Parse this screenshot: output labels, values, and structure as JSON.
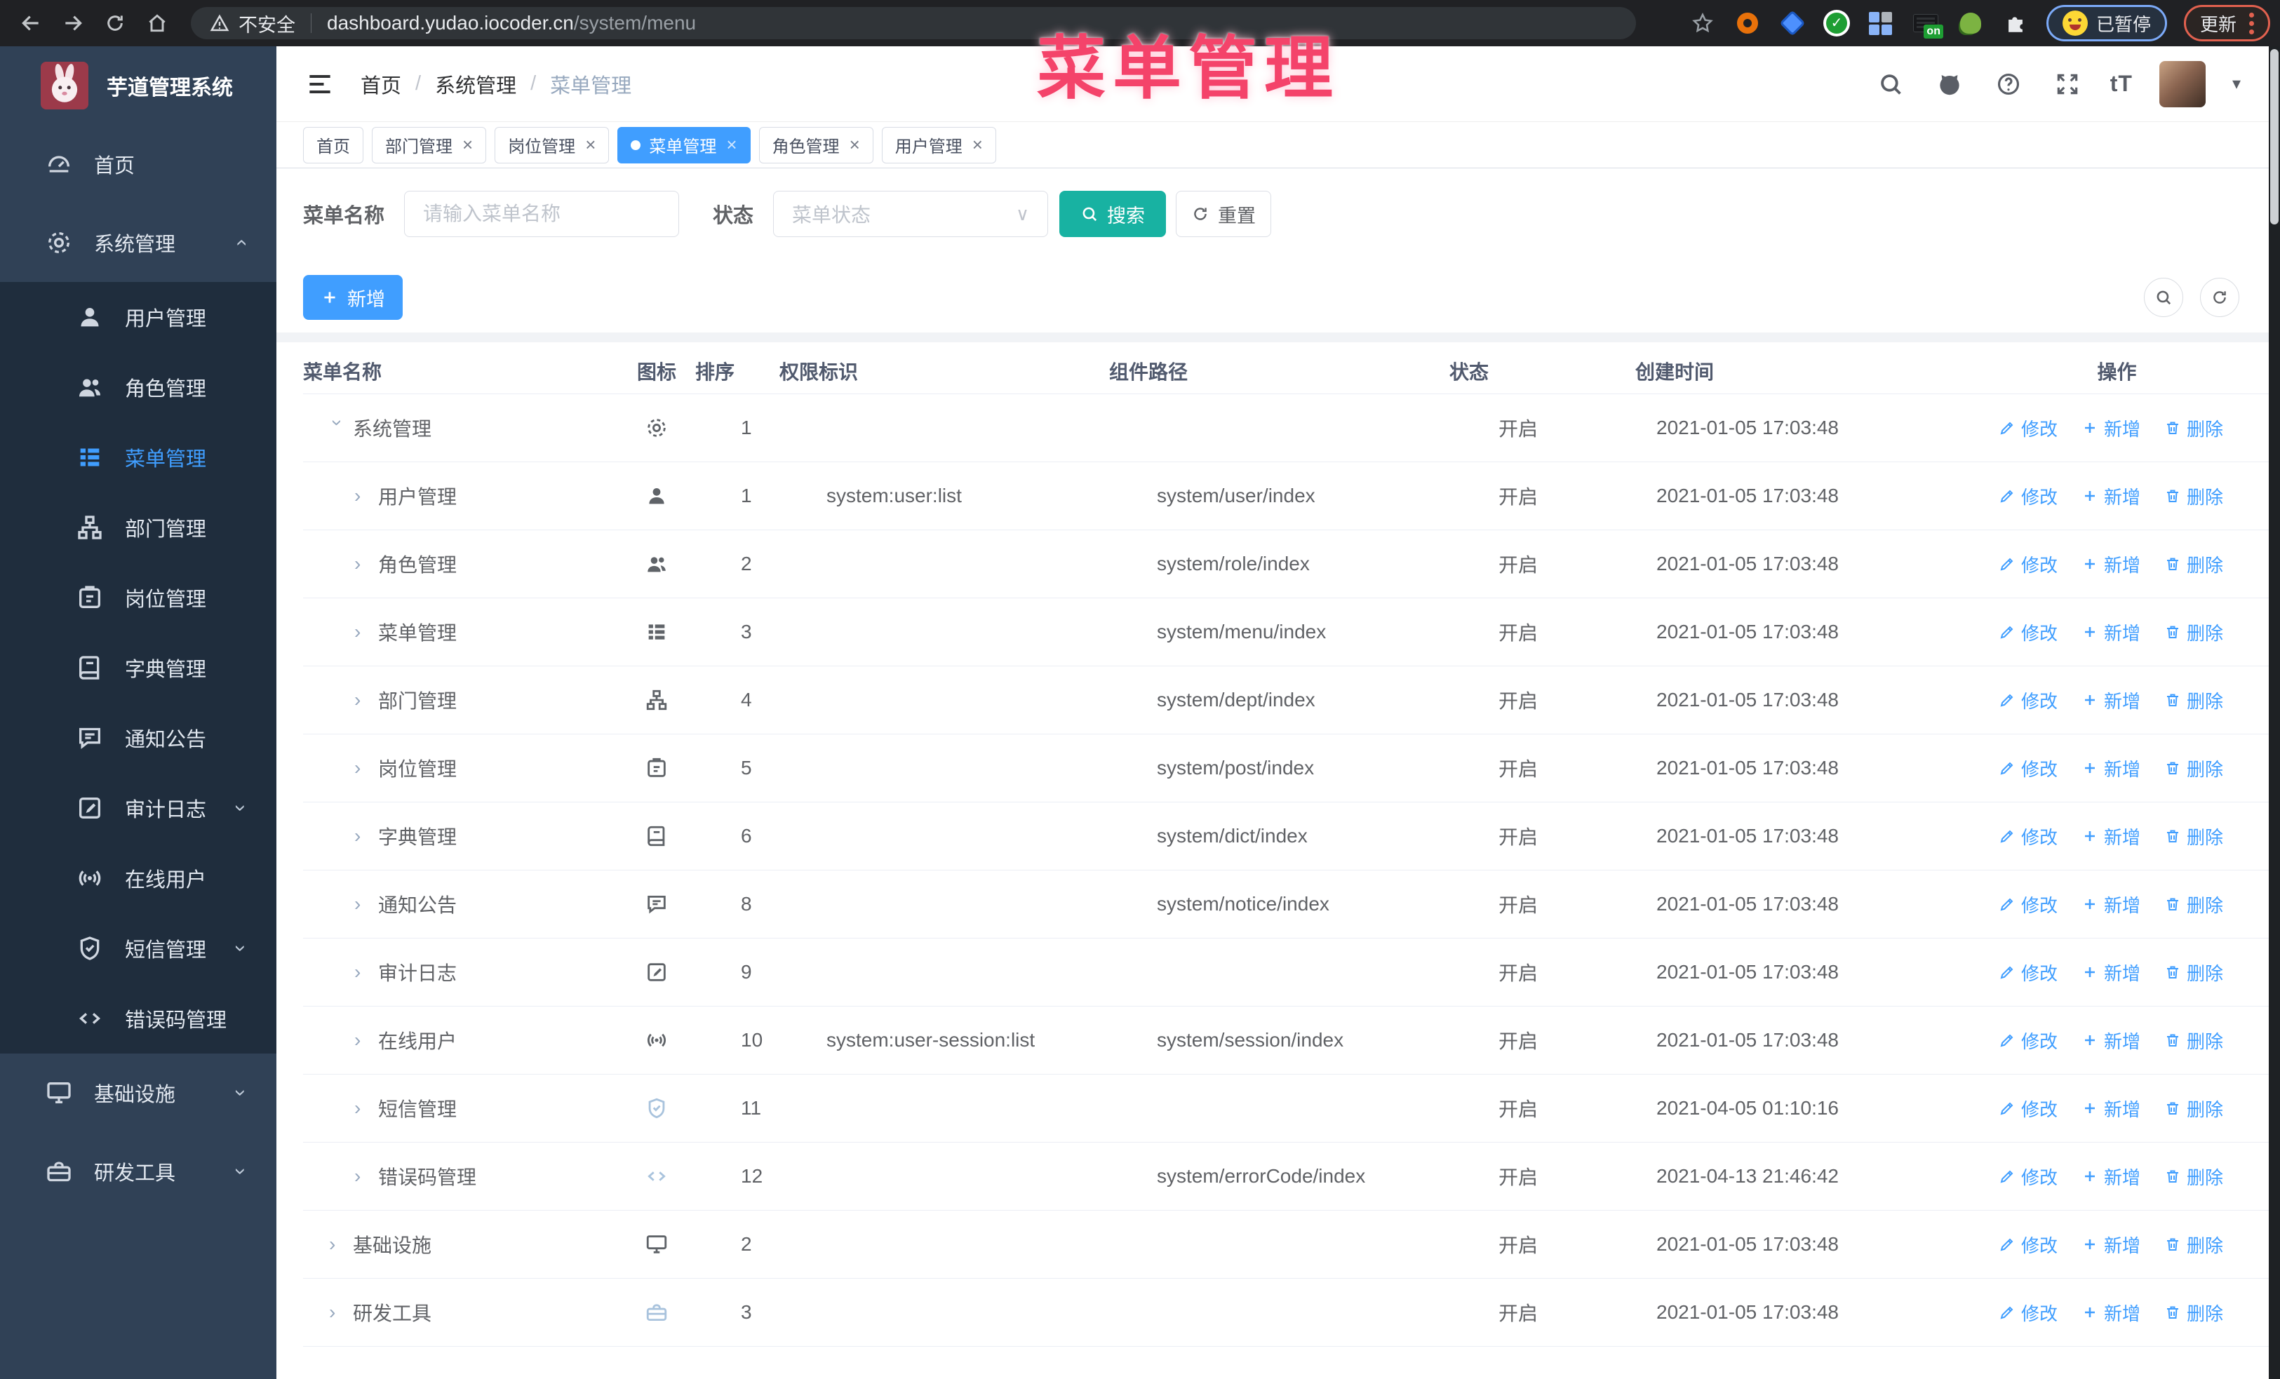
{
  "browser": {
    "security_label": "不安全",
    "url_host": "dashboard.yudao.iocoder.cn",
    "url_path": "/system/menu",
    "profile_badge": "已暂停",
    "update_button": "更新",
    "extension_on_badge": "on"
  },
  "overlay": {
    "title": "菜单管理",
    "color": "#f4436a"
  },
  "sidebar": {
    "app_title": "芋道管理系统",
    "items": [
      {
        "label": "首页",
        "icon": "dashboard",
        "level": 0
      },
      {
        "label": "系统管理",
        "icon": "gear",
        "level": 0,
        "arrow": "up"
      },
      {
        "label": "用户管理",
        "icon": "user",
        "level": 1
      },
      {
        "label": "角色管理",
        "icon": "users",
        "level": 1
      },
      {
        "label": "菜单管理",
        "icon": "menu",
        "level": 1,
        "active": true
      },
      {
        "label": "部门管理",
        "icon": "tree",
        "level": 1
      },
      {
        "label": "岗位管理",
        "icon": "post",
        "level": 1
      },
      {
        "label": "字典管理",
        "icon": "dict",
        "level": 1
      },
      {
        "label": "通知公告",
        "icon": "message",
        "level": 1
      },
      {
        "label": "审计日志",
        "icon": "log",
        "level": 1,
        "arrow": "down"
      },
      {
        "label": "在线用户",
        "icon": "online",
        "level": 1
      },
      {
        "label": "短信管理",
        "icon": "shield",
        "level": 1,
        "arrow": "down"
      },
      {
        "label": "错误码管理",
        "icon": "code",
        "level": 1
      },
      {
        "label": "基础设施",
        "icon": "monitor",
        "level": 0,
        "arrow": "down"
      },
      {
        "label": "研发工具",
        "icon": "toolbox",
        "level": 0,
        "arrow": "down"
      }
    ]
  },
  "header": {
    "breadcrumb": [
      "首页",
      "系统管理",
      "菜单管理"
    ],
    "breadcrumb_separator": "/",
    "font_size_glyph": "tT"
  },
  "tabs": {
    "close_glyph": "×",
    "items": [
      {
        "label": "首页",
        "closable": false,
        "active": false
      },
      {
        "label": "部门管理",
        "closable": true,
        "active": false
      },
      {
        "label": "岗位管理",
        "closable": true,
        "active": false
      },
      {
        "label": "菜单管理",
        "closable": true,
        "active": true
      },
      {
        "label": "角色管理",
        "closable": true,
        "active": false
      },
      {
        "label": "用户管理",
        "closable": true,
        "active": false
      }
    ]
  },
  "filters": {
    "name_label": "菜单名称",
    "name_placeholder": "请输入菜单名称",
    "status_label": "状态",
    "status_placeholder": "菜单状态",
    "search_label": "搜索",
    "reset_label": "重置"
  },
  "toolbar": {
    "add_label": "新增"
  },
  "table": {
    "columns": [
      "菜单名称",
      "图标",
      "排序",
      "权限标识",
      "组件路径",
      "状态",
      "创建时间",
      "操作"
    ],
    "actions": {
      "edit": "修改",
      "add": "新增",
      "delete": "删除"
    },
    "rows": [
      {
        "name": "系统管理",
        "icon": "gear",
        "level": 0,
        "expanded": true,
        "sort": "1",
        "perm": "",
        "path": "",
        "status": "开启",
        "time": "2021-01-05 17:03:48"
      },
      {
        "name": "用户管理",
        "icon": "user",
        "level": 1,
        "expanded": false,
        "sort": "1",
        "perm": "system:user:list",
        "path": "system/user/index",
        "status": "开启",
        "time": "2021-01-05 17:03:48"
      },
      {
        "name": "角色管理",
        "icon": "users",
        "level": 1,
        "expanded": false,
        "sort": "2",
        "perm": "",
        "path": "system/role/index",
        "status": "开启",
        "time": "2021-01-05 17:03:48"
      },
      {
        "name": "菜单管理",
        "icon": "menu",
        "level": 1,
        "expanded": false,
        "sort": "3",
        "perm": "",
        "path": "system/menu/index",
        "status": "开启",
        "time": "2021-01-05 17:03:48"
      },
      {
        "name": "部门管理",
        "icon": "tree",
        "level": 1,
        "expanded": false,
        "sort": "4",
        "perm": "",
        "path": "system/dept/index",
        "status": "开启",
        "time": "2021-01-05 17:03:48"
      },
      {
        "name": "岗位管理",
        "icon": "post",
        "level": 1,
        "expanded": false,
        "sort": "5",
        "perm": "",
        "path": "system/post/index",
        "status": "开启",
        "time": "2021-01-05 17:03:48"
      },
      {
        "name": "字典管理",
        "icon": "dict",
        "level": 1,
        "expanded": false,
        "sort": "6",
        "perm": "",
        "path": "system/dict/index",
        "status": "开启",
        "time": "2021-01-05 17:03:48"
      },
      {
        "name": "通知公告",
        "icon": "message",
        "level": 1,
        "expanded": false,
        "sort": "8",
        "perm": "",
        "path": "system/notice/index",
        "status": "开启",
        "time": "2021-01-05 17:03:48"
      },
      {
        "name": "审计日志",
        "icon": "log",
        "level": 1,
        "expanded": false,
        "sort": "9",
        "perm": "",
        "path": "",
        "status": "开启",
        "time": "2021-01-05 17:03:48"
      },
      {
        "name": "在线用户",
        "icon": "online",
        "level": 1,
        "expanded": false,
        "sort": "10",
        "perm": "system:user-session:list",
        "path": "system/session/index",
        "status": "开启",
        "time": "2021-01-05 17:03:48"
      },
      {
        "name": "短信管理",
        "icon": "shield",
        "level": 1,
        "expanded": false,
        "sort": "11",
        "perm": "",
        "path": "",
        "status": "开启",
        "time": "2021-04-05 01:10:16",
        "muted": true
      },
      {
        "name": "错误码管理",
        "icon": "code",
        "level": 1,
        "expanded": false,
        "sort": "12",
        "perm": "",
        "path": "system/errorCode/index",
        "status": "开启",
        "time": "2021-04-13 21:46:42",
        "muted": true
      },
      {
        "name": "基础设施",
        "icon": "monitor",
        "level": 0,
        "expanded": false,
        "sort": "2",
        "perm": "",
        "path": "",
        "status": "开启",
        "time": "2021-01-05 17:03:48"
      },
      {
        "name": "研发工具",
        "icon": "toolbox",
        "level": 0,
        "expanded": false,
        "sort": "3",
        "perm": "",
        "path": "",
        "status": "开启",
        "time": "2021-01-05 17:03:48",
        "muted": true
      }
    ]
  }
}
